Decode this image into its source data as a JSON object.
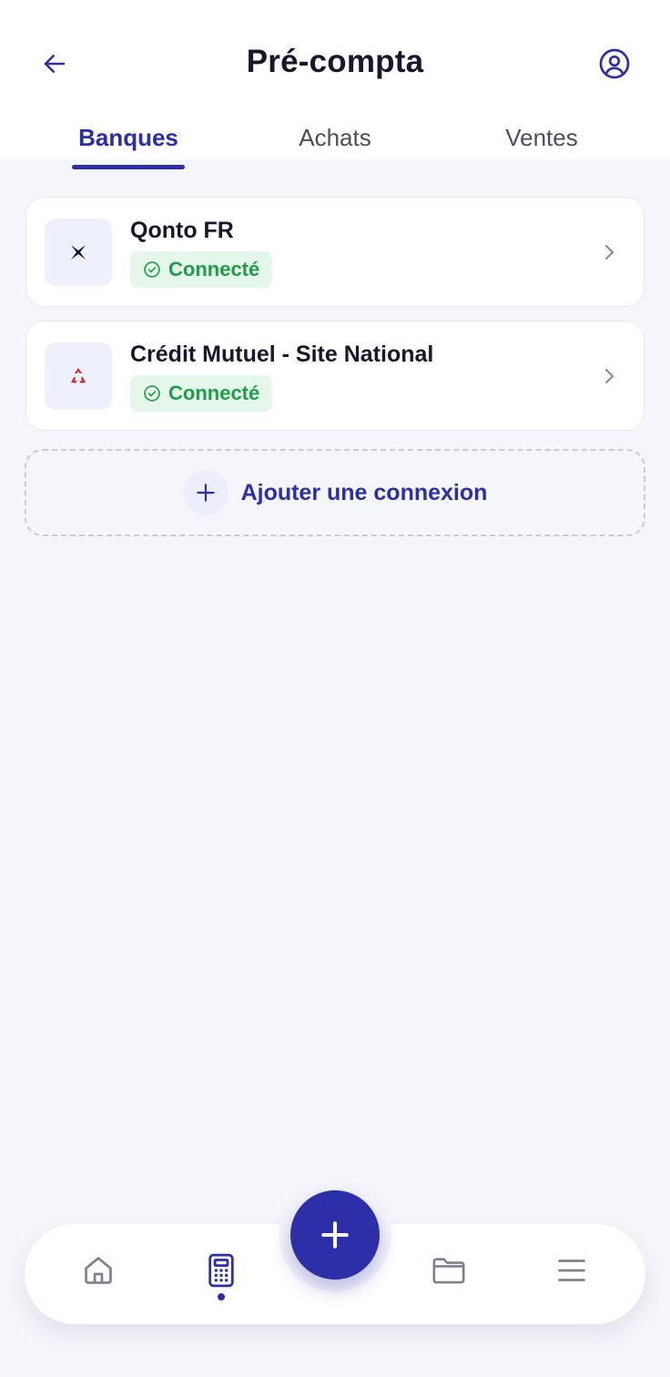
{
  "header": {
    "title": "Pré-compta",
    "back_icon": "arrow-left-icon",
    "profile_icon": "user-circle-icon"
  },
  "tabs": [
    {
      "label": "Banques",
      "active": true
    },
    {
      "label": "Achats",
      "active": false
    },
    {
      "label": "Ventes",
      "active": false
    }
  ],
  "banks": [
    {
      "name": "Qonto FR",
      "status": "Connecté",
      "logo_icon": "qonto-logo-icon"
    },
    {
      "name": "Crédit Mutuel - Site National",
      "status": "Connecté",
      "logo_icon": "credit-mutuel-logo-icon"
    }
  ],
  "add_connection": {
    "label": "Ajouter une connexion",
    "icon": "plus-icon"
  },
  "bottom_nav": {
    "items": [
      {
        "icon": "home-icon",
        "active": false
      },
      {
        "icon": "calculator-icon",
        "active": true
      },
      {
        "icon": "folder-icon",
        "active": false
      },
      {
        "icon": "menu-icon",
        "active": false
      }
    ],
    "fab_icon": "plus-icon"
  },
  "colors": {
    "accent": "#2c2fa8",
    "success": "#1f9d4a",
    "success_bg": "#e5f6ea",
    "background": "#f5f6fb"
  }
}
